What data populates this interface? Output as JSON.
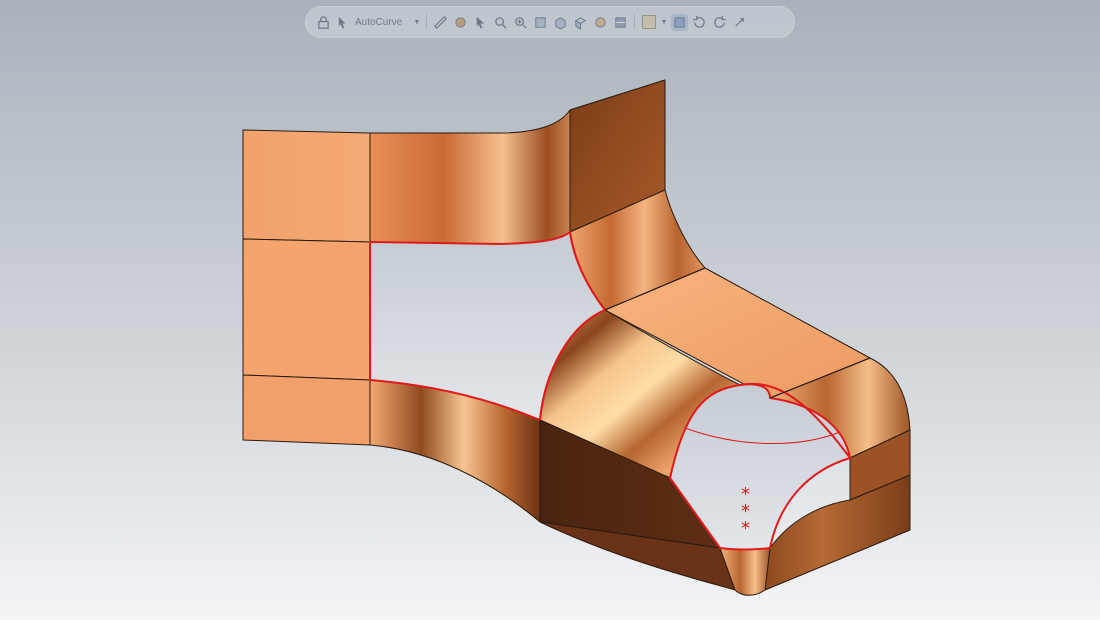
{
  "app": {
    "view": "3d-model-viewport",
    "toolbar": {
      "buttons": [
        {
          "id": "lock",
          "icon": "lock-icon"
        },
        {
          "id": "select-filter",
          "icon": "select-filter-icon"
        },
        {
          "id": "measure",
          "icon": "measure-icon"
        },
        {
          "id": "paint",
          "icon": "paint-icon"
        },
        {
          "id": "pointer",
          "icon": "pointer-icon"
        },
        {
          "id": "zoom-fit",
          "icon": "zoom-fit-icon"
        },
        {
          "id": "zoom-area",
          "icon": "zoom-area-icon"
        },
        {
          "id": "view-front",
          "icon": "view-front-icon"
        },
        {
          "id": "view-top",
          "icon": "view-top-icon"
        },
        {
          "id": "view-iso",
          "icon": "view-iso-icon"
        },
        {
          "id": "view-orient",
          "icon": "view-orient-icon"
        },
        {
          "id": "section",
          "icon": "section-icon"
        },
        {
          "id": "appearance",
          "icon": "appearance-icon"
        },
        {
          "id": "display-style",
          "icon": "display-style-icon"
        },
        {
          "id": "rotate",
          "icon": "rotate-icon"
        },
        {
          "id": "refresh",
          "icon": "refresh-icon"
        },
        {
          "id": "settings",
          "icon": "settings-icon"
        }
      ],
      "combo_label": "AutoCurve"
    },
    "colors": {
      "copper_light": "#F4A56F",
      "copper_mid": "#D9824F",
      "copper_dark": "#6B3518",
      "edge_highlight": "#E01A1A",
      "background_top": "#A9B2BC",
      "background_bottom": "#F3F4F6"
    },
    "annotations": {
      "asterisks": [
        "*",
        "*",
        "*"
      ]
    }
  }
}
